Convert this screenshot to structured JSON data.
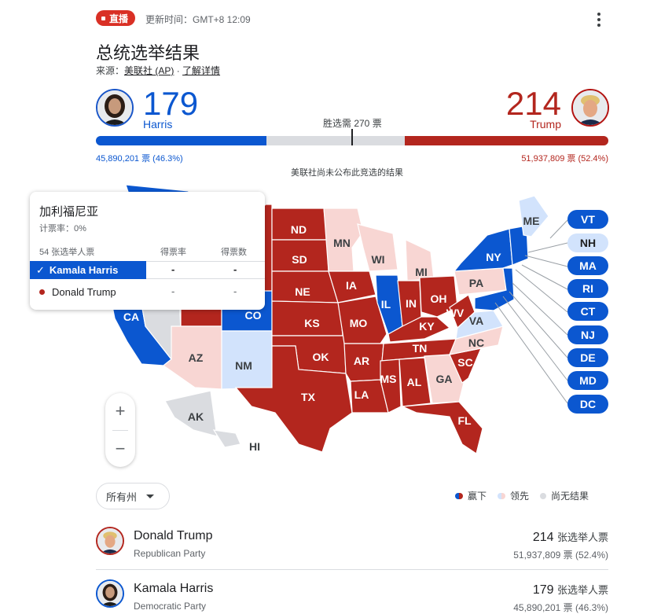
{
  "header": {
    "live_label": "直播",
    "updated": "更新时间：GMT+8 12:09",
    "title": "总统选举结果",
    "source_prefix": "来源：",
    "source_link": "美联社 (AP)",
    "source_sep": " · ",
    "details_link": "了解详情"
  },
  "colors": {
    "dem": "#0b57d0",
    "rep": "#b3261e",
    "dem_lead": "#d2e3fc",
    "rep_lead": "#f8d6d3",
    "no_result": "#dadce0"
  },
  "scoreboard": {
    "dem": {
      "electoral_votes": "179",
      "name": "Harris",
      "popular": "45,890,201 票 (46.3%)",
      "avatar": "harris-avatar"
    },
    "rep": {
      "electoral_votes": "214",
      "name": "Trump",
      "popular": "51,937,809 票 (52.4%)",
      "avatar": "trump-avatar"
    },
    "to_win": "胜选需 270 票",
    "dem_fraction": 0.333,
    "rep_fraction": 0.397,
    "threshold_fraction": 0.5,
    "notice": "美联社尚未公布此竞选的结果"
  },
  "popup": {
    "state": "加利福尼亚",
    "reporting": "计票率：0%",
    "col_votes_label": "54 张选举人票",
    "col_pct": "得票率",
    "col_count": "得票数",
    "rows": [
      {
        "name": "Kamala Harris",
        "pct": "-",
        "count": "-",
        "selected": true
      },
      {
        "name": "Donald Trump",
        "pct": "-",
        "count": "-",
        "selected": false
      }
    ]
  },
  "map": {
    "labels": [
      "ND",
      "MN",
      "SD",
      "WI",
      "NE",
      "IA",
      "MI",
      "IL",
      "IN",
      "OH",
      "PA",
      "NY",
      "ME",
      "CO",
      "KS",
      "MO",
      "KY",
      "WV",
      "VA",
      "CA",
      "AZ",
      "NM",
      "OK",
      "AR",
      "TN",
      "NC",
      "SC",
      "TX",
      "LA",
      "MS",
      "AL",
      "GA",
      "FL",
      "AK",
      "HI"
    ],
    "callouts": [
      "VT",
      "NH",
      "MA",
      "RI",
      "CT",
      "NJ",
      "DE",
      "MD",
      "DC"
    ]
  },
  "zoom": {
    "in": "+",
    "out": "−"
  },
  "filter": {
    "label": "所有州"
  },
  "legend": {
    "won": "赢下",
    "leading": "领先",
    "no_result": "尚无结果"
  },
  "candidates": [
    {
      "name": "Donald Trump",
      "party": "Republican Party",
      "ev": "214",
      "ev_unit": "张选举人票",
      "popular": "51,937,809 票 (52.4%)"
    },
    {
      "name": "Kamala Harris",
      "party": "Democratic Party",
      "ev": "179",
      "ev_unit": "张选举人票",
      "popular": "45,890,201 票 (46.3%)"
    }
  ]
}
